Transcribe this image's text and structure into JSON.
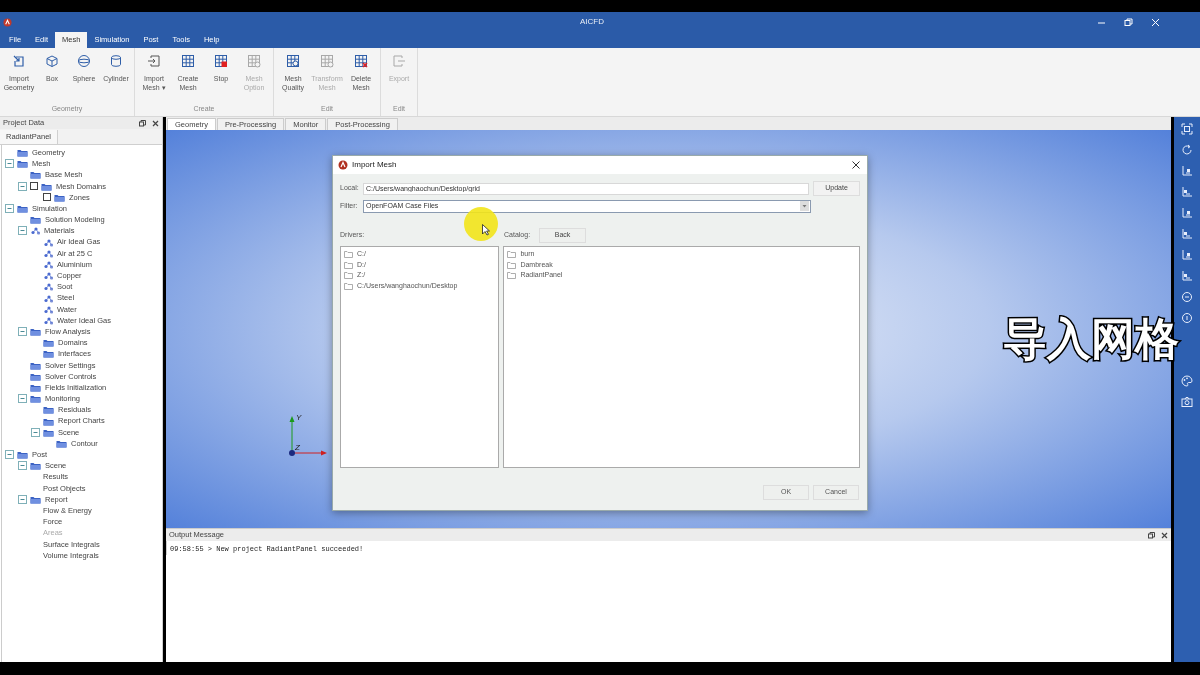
{
  "window": {
    "title": "AICFD"
  },
  "menu": [
    {
      "label": "File",
      "selected": false
    },
    {
      "label": "Edit",
      "selected": false
    },
    {
      "label": "Mesh",
      "selected": true
    },
    {
      "label": "Simulation",
      "selected": false
    },
    {
      "label": "Post",
      "selected": false
    },
    {
      "label": "Tools",
      "selected": false
    },
    {
      "label": "Help",
      "selected": false
    }
  ],
  "ribbon": [
    {
      "label": "Geometry",
      "buttons": [
        {
          "label": "Import Geometry",
          "kind": "import_geometry",
          "disabled": false
        },
        {
          "label": "Box",
          "kind": "box",
          "disabled": false
        },
        {
          "label": "Sphere",
          "kind": "sphere",
          "disabled": false
        },
        {
          "label": "Cylinder",
          "kind": "cylinder",
          "disabled": false
        }
      ]
    },
    {
      "label": "Create",
      "buttons": [
        {
          "label": "Import Mesh",
          "caret": "▾",
          "kind": "import",
          "disabled": false
        },
        {
          "label": "Create Mesh",
          "kind": "grid",
          "disabled": false
        },
        {
          "label": "Stop",
          "kind": "stop",
          "disabled": false
        },
        {
          "label": "Mesh Option",
          "kind": "grid_gear",
          "disabled": true
        }
      ]
    },
    {
      "label": "Edit",
      "buttons": [
        {
          "label": "Mesh Quality",
          "kind": "grid_search",
          "disabled": false
        },
        {
          "label": "Transform Mesh",
          "kind": "grid_gear",
          "disabled": true
        },
        {
          "label": "Delete Mesh",
          "kind": "grid_delete",
          "disabled": false
        }
      ]
    },
    {
      "label": "Edit",
      "buttons": [
        {
          "label": "Export",
          "kind": "export",
          "disabled": true
        }
      ]
    }
  ],
  "project_panel": {
    "title": "Project Data",
    "tab": "RadiantPanel",
    "tree": [
      {
        "label": "Geometry",
        "kind": "folder",
        "disabled": false
      },
      {
        "label": "Mesh",
        "kind": "folder",
        "disabled": false,
        "expanded": true,
        "children": [
          {
            "label": "Base Mesh",
            "kind": "folder",
            "disabled": false
          },
          {
            "label": "Mesh Domains",
            "kind": "folder",
            "disabled": false,
            "checked": false,
            "expanded": true,
            "children": [
              {
                "label": "Zones",
                "kind": "folder",
                "disabled": false,
                "checked": false
              }
            ]
          }
        ]
      },
      {
        "label": "Simulation",
        "kind": "folder",
        "disabled": false,
        "expanded": true,
        "children": [
          {
            "label": "Solution Modeling",
            "kind": "folder",
            "disabled": false
          },
          {
            "label": "Materials",
            "kind": "material",
            "disabled": false,
            "expanded": true,
            "children": [
              {
                "label": "Air Ideal Gas",
                "kind": "material",
                "disabled": false
              },
              {
                "label": "Air at 25 C",
                "kind": "material",
                "disabled": false
              },
              {
                "label": "Aluminium",
                "kind": "material",
                "disabled": false
              },
              {
                "label": "Copper",
                "kind": "material",
                "disabled": false
              },
              {
                "label": "Soot",
                "kind": "material",
                "disabled": false
              },
              {
                "label": "Steel",
                "kind": "material",
                "disabled": false
              },
              {
                "label": "Water",
                "kind": "material",
                "disabled": false
              },
              {
                "label": "Water Ideal Gas",
                "kind": "material",
                "disabled": false
              }
            ]
          },
          {
            "label": "Flow Analysis",
            "kind": "folder",
            "disabled": false,
            "expanded": true,
            "children": [
              {
                "label": "Domains",
                "kind": "folder",
                "disabled": false
              },
              {
                "label": "Interfaces",
                "kind": "folder",
                "disabled": false
              }
            ]
          },
          {
            "label": "Solver Settings",
            "kind": "folder",
            "disabled": false
          },
          {
            "label": "Solver Controls",
            "kind": "folder",
            "disabled": false
          },
          {
            "label": "Fields Initialization",
            "kind": "folder",
            "disabled": false
          },
          {
            "label": "Monitoring",
            "kind": "folder",
            "disabled": false,
            "expanded": true,
            "children": [
              {
                "label": "Residuals",
                "kind": "folder",
                "disabled": false
              },
              {
                "label": "Report Charts",
                "kind": "folder",
                "disabled": false
              },
              {
                "label": "Scene",
                "kind": "folder",
                "disabled": false,
                "expanded": true,
                "children": [
                  {
                    "label": "Contour",
                    "kind": "folder",
                    "disabled": false
                  }
                ]
              }
            ]
          }
        ]
      },
      {
        "label": "Post",
        "kind": "folder",
        "disabled": false,
        "expanded": true,
        "children": [
          {
            "label": "Scene",
            "kind": "folder",
            "disabled": false,
            "expanded": true,
            "children": [
              {
                "label": "Results",
                "kind": "text",
                "disabled": false
              },
              {
                "label": "Post Objects",
                "kind": "text",
                "disabled": false
              }
            ]
          },
          {
            "label": "Report",
            "kind": "folder",
            "disabled": false,
            "expanded": true,
            "children": [
              {
                "label": "Flow & Energy",
                "kind": "text",
                "disabled": false
              },
              {
                "label": "Force",
                "kind": "text",
                "disabled": false
              },
              {
                "label": "Areas",
                "kind": "text",
                "disabled": true
              },
              {
                "label": "Surface Integrals",
                "kind": "text",
                "disabled": false
              },
              {
                "label": "Volume Integrals",
                "kind": "text",
                "disabled": false
              }
            ]
          }
        ]
      }
    ]
  },
  "view_tabs": [
    {
      "label": "Geometry",
      "selected": true
    },
    {
      "label": "Pre-Processing",
      "selected": false
    },
    {
      "label": "Monitor",
      "selected": false
    },
    {
      "label": "Post-Processing",
      "selected": false
    }
  ],
  "axes": {
    "y": "Y",
    "z": "Z"
  },
  "dialog": {
    "title": "Import Mesh",
    "local_label": "Local:",
    "local_value": "C:/Users/wanghaochun/Desktop/grid",
    "update": "Update",
    "filter_label": "Filter:",
    "filter_value": "OpenFOAM Case Files",
    "drivers_label": "Drivers:",
    "catalog_label": "Catalog:",
    "back": "Back",
    "drivers": [
      "C:/",
      "D:/",
      "Z:/",
      "C:/Users/wanghaochun/Desktop"
    ],
    "catalog": [
      "burn",
      "Dambreak",
      "RadiantPanel"
    ],
    "ok": "OK",
    "cancel": "Cancel"
  },
  "output": {
    "title": "Output Message",
    "lines": [
      "09:58:55 > New project RadiantPanel succeeded!"
    ]
  },
  "caption": "导入网格"
}
